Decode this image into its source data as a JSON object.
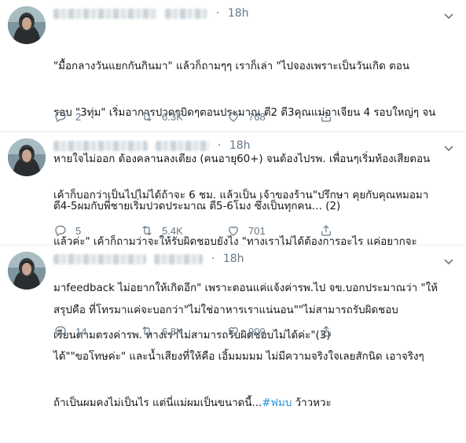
{
  "tweets": [
    {
      "time": "18h",
      "lines": [
        "\"มื้อกลางวันแยกกันกินมา\" แล้วก็ถามๆๆ เราก็เล่า \"ไปจองเพราะเป็นวันเกิด ตอน",
        "รอบ \"3ทุ่ม\" เริ่มอาการปวดๆบิดๆตอนประมาณ ตี2 ตี3คุณแม่อาเจียน 4 รอบใหญ่ๆ จน",
        "หายใจไม่ออก ต้องคลานลงเตียง (คนอายุ60+) จนต้องไปรพ. เพื่อนๆเริ่มท้องเสียตอน",
        "ตี4-5ผมกับพี่ชายเริ่มปวดประมาณ ตี5-6โมง ซึ่งเป็นทุกคน… (2)"
      ],
      "replies": "2",
      "retweets": "6.3K",
      "likes": "768"
    },
    {
      "time": "18h",
      "lines": [
        "เค้าก็บอกว่าเป็นไปไม่ได้ถ้าจะ 6 ชม. แล้วเป็น เจ้าของร้าน\"ปรึกษา คุยกับคุณหมอมา",
        "แล้วค่ะ\" เค้าก็ถามว่าจะให้รับผิดชอบยังไง \"ทางเราไม่ได้ต้องการอะไร แค่อยากจะ",
        "มาfeedback ไม่อยากให้เกิดอีก\" เพราะตอนแค่แจ้งค่ารพ.ไป จข.บอกประมาณว่า \"ให้",
        "เรียนตามตรงค่ารพ. ทางเราไม่สามารถรับผิดชอบไม่ได้ค่ะ\"(3)"
      ],
      "replies": "5",
      "retweets": "5.4K",
      "likes": "701"
    },
    {
      "time": "18h",
      "lines": [
        "สรุปคือ ที่โทรมาแค่จะบอกว่า\"ไม่ใช่อาหารเราแน่นอน\"\"ไม่สามารถรับผิดชอบ",
        "ได้\"\"ขอโทษค่ะ\" และน้ำเสียงที่ให้คือ เอิ้มมมมม ไม่มีความจริงใจเลยสักนิด เอาจริงๆ",
        "ถ้าเป็นผมคงไม่เป็นไร แต่นี่แม่ผมเป็นขนาดนี้..."
      ],
      "hashtag": "#ฟมบ",
      "tail": " ว้าวหวะ",
      "replies": "14",
      "retweets": "6.8K",
      "likes": "909"
    }
  ],
  "icons": {
    "reply": "reply-icon",
    "retweet": "retweet-icon",
    "like": "heart-icon",
    "share": "share-icon",
    "more": "chevron-down-icon"
  },
  "colors": {
    "text": "#14171a",
    "secondary": "#657786",
    "hashtag": "#1b95e0",
    "divider": "#e6ecf0"
  }
}
